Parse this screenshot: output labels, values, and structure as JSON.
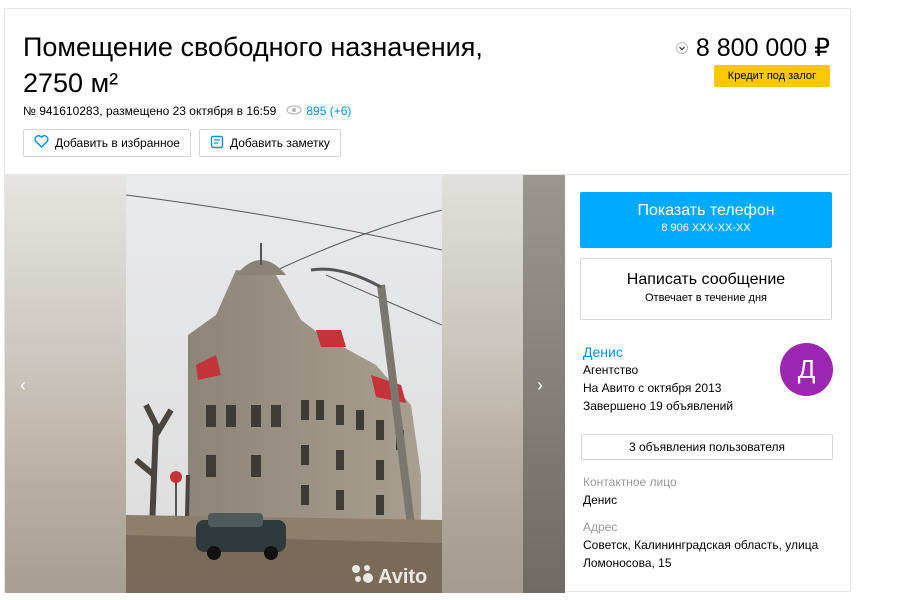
{
  "listing": {
    "title": "Помещение свободного назначения, 2750 м²",
    "price": "8 800 000 ₽",
    "credit_badge": "Кредит под залог",
    "meta": "№ 941610283, размещено 23 октября в 16:59",
    "views": "895 (+6)",
    "favorite_label": "Добавить в избранное",
    "note_label": "Добавить заметку"
  },
  "gallery": {
    "prev_arrow": "‹",
    "next_arrow": "›",
    "watermark": "Avito"
  },
  "contact_panel": {
    "phone_button": "Показать телефон",
    "phone_masked": "8 906 XXX-XX-XX",
    "message_button": "Написать сообщение",
    "message_sub": "Отвечает в течение дня",
    "seller_name": "Денис",
    "seller_type": "Агентство",
    "seller_since": "На Авито с октября 2013",
    "seller_completed": "Завершено 19 объявлений",
    "avatar_letter": "Д",
    "avatar_color": "#9c27b0",
    "listings_button": "3 объявления пользователя",
    "contact_label": "Контактное лицо",
    "contact_name": "Денис",
    "address_label": "Адрес",
    "address": "Советск, Калининградская область, улица Ломоносова, 15"
  },
  "colors": {
    "accent_blue": "#00aaff",
    "link_blue": "#0091d9",
    "badge_yellow": "#ffc800"
  }
}
